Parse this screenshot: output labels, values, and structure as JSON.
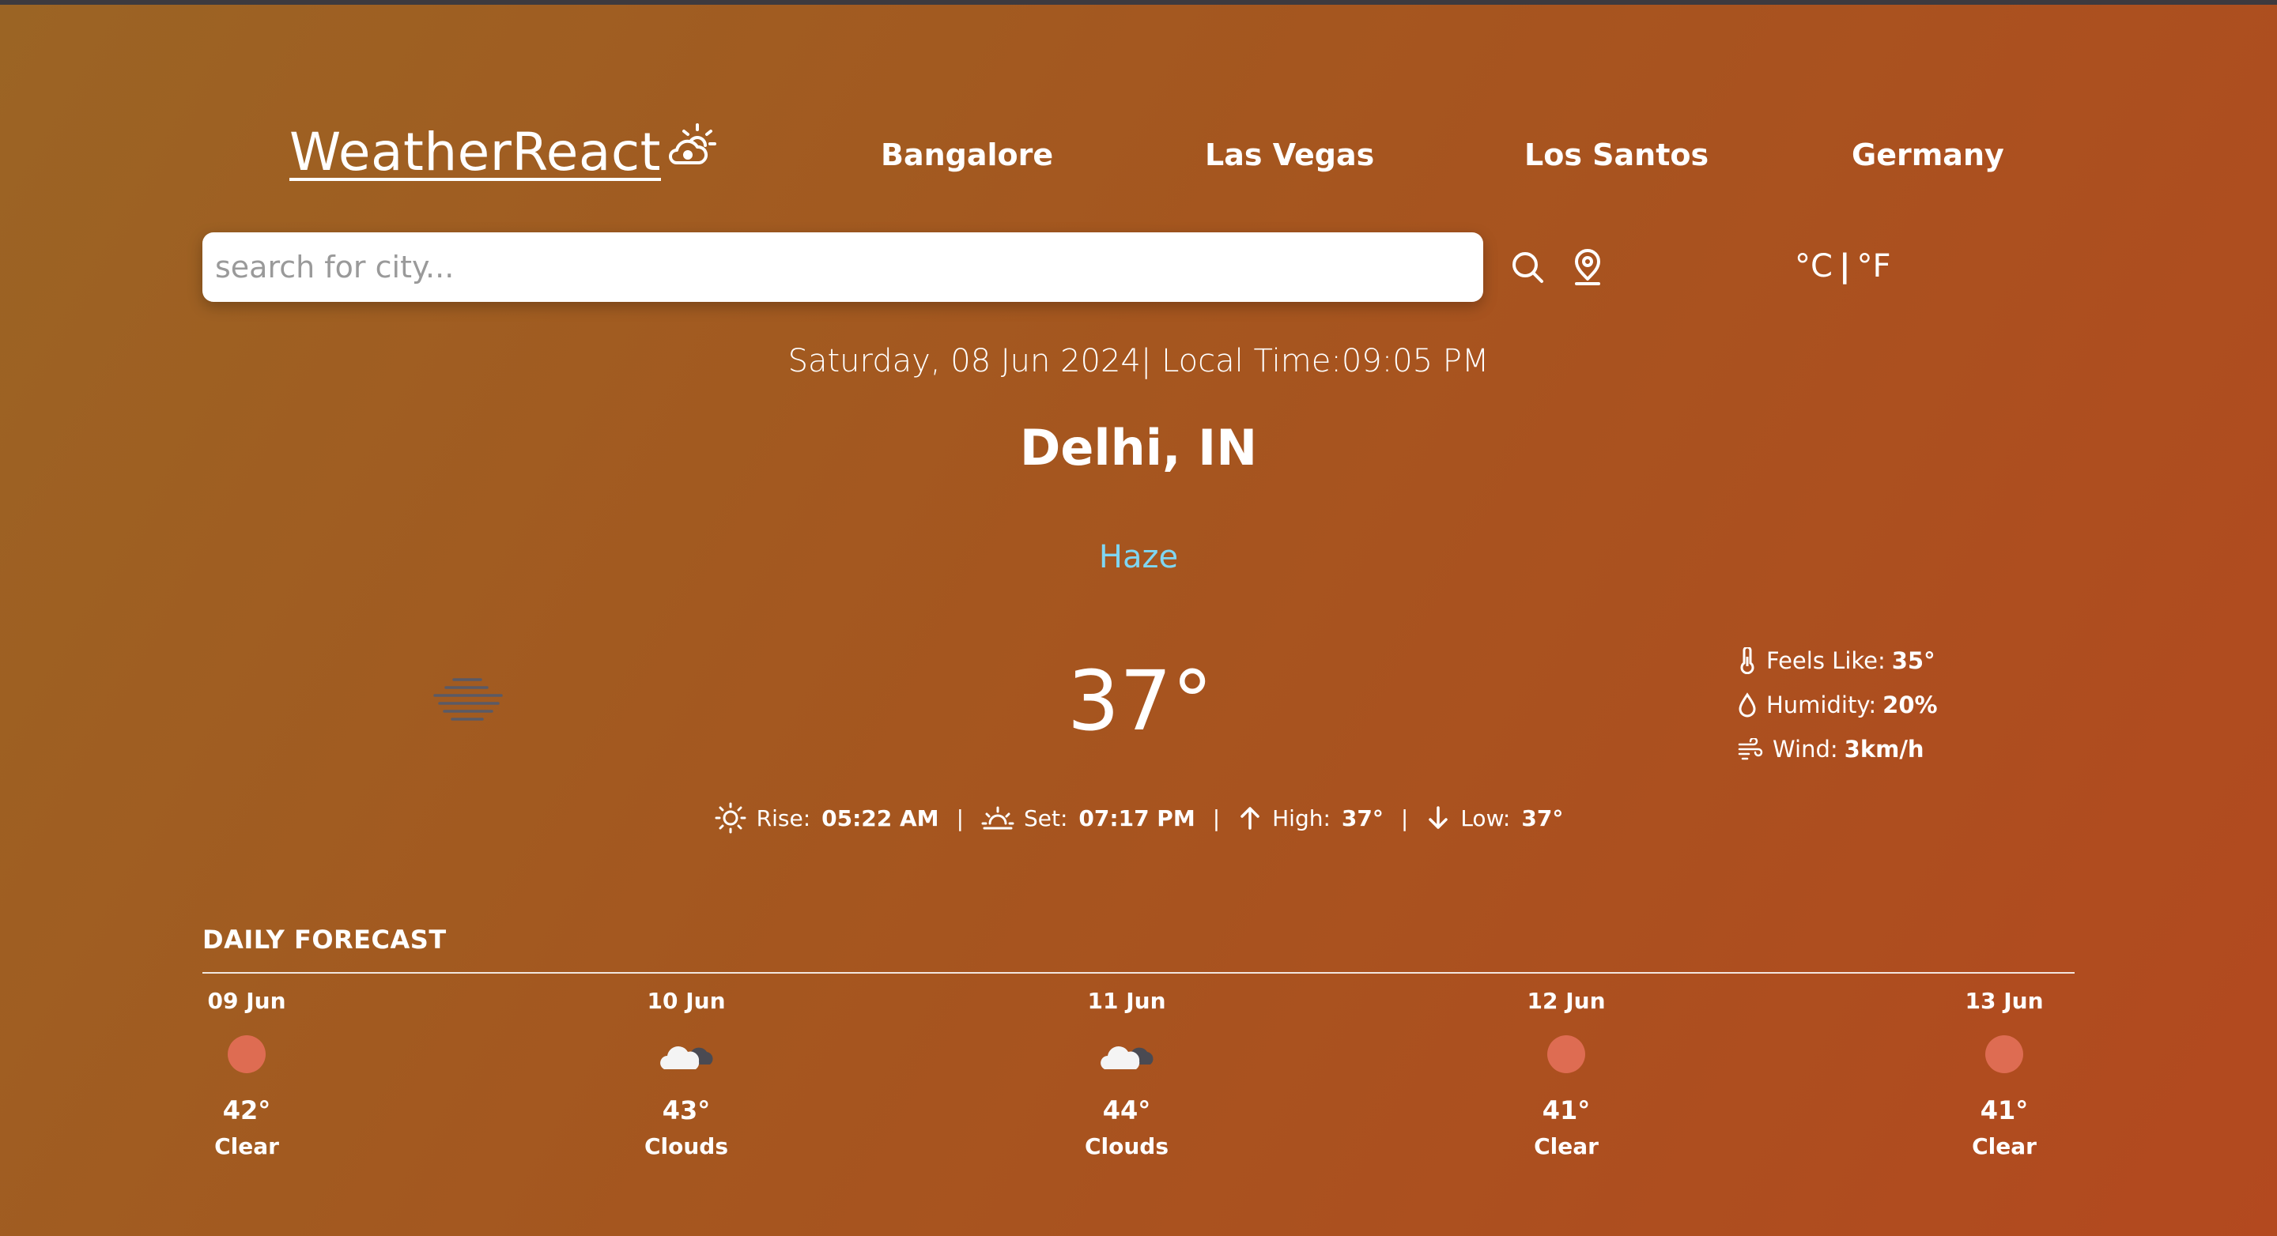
{
  "header": {
    "logo_text": "WeatherReact",
    "nav_links": [
      "Bangalore",
      "Las Vegas",
      "Los Santos",
      "Germany"
    ]
  },
  "search": {
    "placeholder": "search for city...",
    "value": ""
  },
  "units": {
    "celsius": "°C",
    "separator": "|",
    "fahrenheit": "°F"
  },
  "current": {
    "datetime": "Saturday, 08 Jun 2024| Local Time:09:05 PM",
    "city": "Delhi, IN",
    "condition": "Haze",
    "temperature": "37°",
    "feels_like_label": "Feels Like:",
    "feels_like": "35°",
    "humidity_label": "Humidity:",
    "humidity": "20%",
    "wind_label": "Wind:",
    "wind": "3km/h",
    "rise_label": "Rise:",
    "rise": "05:22 AM",
    "set_label": "Set:",
    "set": "07:17 PM",
    "high_label": "High:",
    "high": "37°",
    "low_label": "Low:",
    "low": "37°",
    "separator": "|"
  },
  "forecast": {
    "title": "DAILY FORECAST",
    "days": [
      {
        "date": "09 Jun",
        "icon": "sun-icon",
        "temp": "42°",
        "desc": "Clear"
      },
      {
        "date": "10 Jun",
        "icon": "cloud-icon",
        "temp": "43°",
        "desc": "Clouds"
      },
      {
        "date": "11 Jun",
        "icon": "cloud-icon",
        "temp": "44°",
        "desc": "Clouds"
      },
      {
        "date": "12 Jun",
        "icon": "sun-icon",
        "temp": "41°",
        "desc": "Clear"
      },
      {
        "date": "13 Jun",
        "icon": "sun-icon",
        "temp": "41°",
        "desc": "Clear"
      }
    ]
  },
  "colors": {
    "condition": "#7fd6f2",
    "sun_dot": "#de6c52",
    "background_start": "#9b6424",
    "background_end": "#b3491f"
  }
}
